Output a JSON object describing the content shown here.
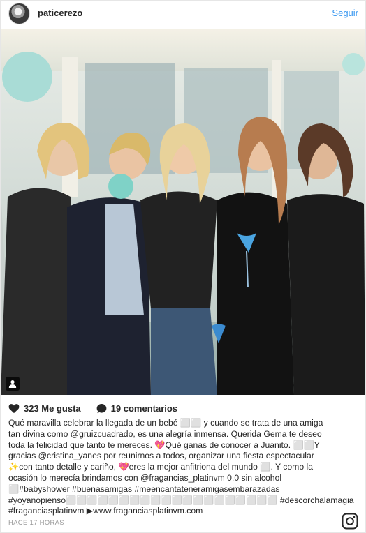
{
  "post": {
    "username": "paticerezo",
    "follow_label": "Seguir",
    "likes": "323 Me gusta",
    "comments": "19 comentarios",
    "caption_lines": [
      "Qué maravilla celebrar la llegada de un bebé ⬜⬜ y cuando se trata de una amiga",
      "tan divina como @gruizcuadrado, es una alegría inmensa. Querida Gema te deseo",
      "toda la felicidad que tanto te mereces. 💖Qué ganas de conocer a Juanito. ⬜⬜Y",
      "gracias @cristina_yanes por reunirnos a todos, organizar una fiesta espectacular",
      "✨con tanto detalle y cariño, 💖eres la mejor anfitriona del mundo ⬜. Y como la",
      "ocasión lo merecía brindamos con @fragancias_platinvm 0,0 sin alcohol",
      "⬜#babyshower #buenasamigas #meencantateneramigasembarazadas",
      "#yoyanopienso⬜⬜⬜⬜⬜⬜⬜⬜⬜⬜⬜⬜⬜⬜⬜⬜⬜⬜⬜⬜     #descorchalamagia",
      "#fraganciasplatinvm ▶www.fraganciasplatinvm.com"
    ],
    "timestamp": "HACE 17 HORAS"
  },
  "icons": {
    "avatar": "avatar",
    "tag": "person-tag-icon",
    "like": "heart-icon",
    "comment": "comment-bubble-icon",
    "logo": "instagram-logo-icon"
  },
  "colors": {
    "link": "#3897f0",
    "text": "#262626",
    "muted": "#999999"
  }
}
